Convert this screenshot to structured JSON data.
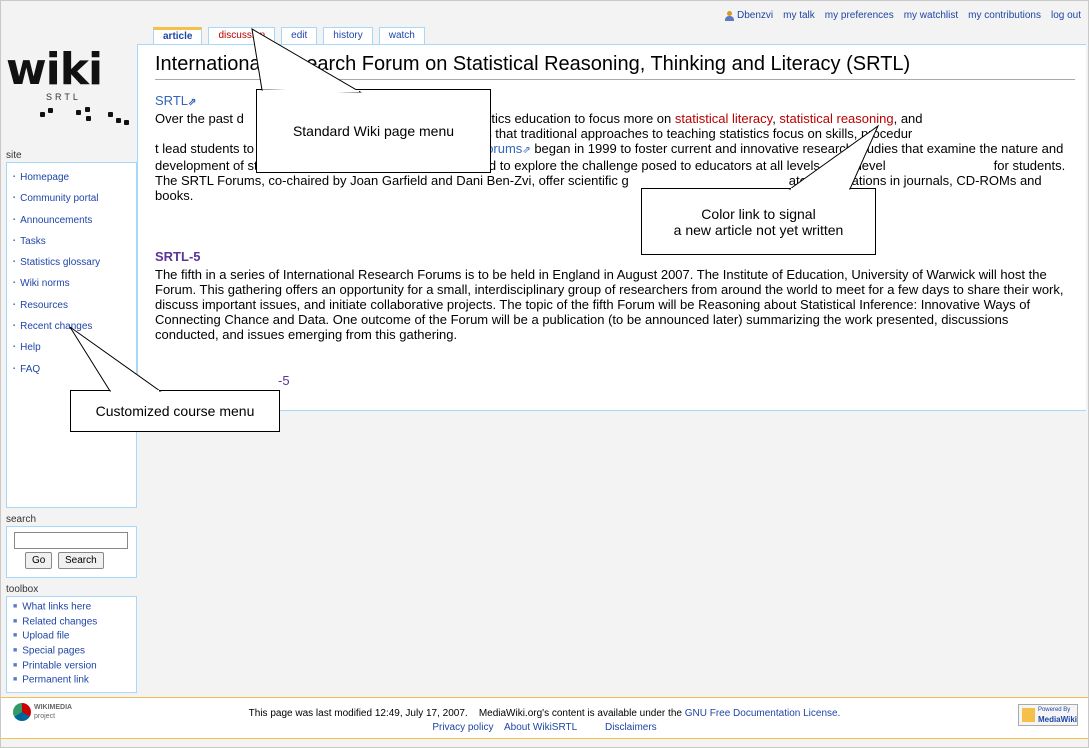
{
  "personal": {
    "user": "Dbenzvi",
    "links": [
      "my talk",
      "my preferences",
      "my watchlist",
      "my contributions",
      "log out"
    ]
  },
  "logo": {
    "text": "wiki",
    "subtext": "SRTL"
  },
  "tabs": [
    {
      "label": "article",
      "state": "selected"
    },
    {
      "label": "discussion",
      "state": "new"
    },
    {
      "label": "edit",
      "state": "normal"
    },
    {
      "label": "history",
      "state": "normal"
    },
    {
      "label": "watch",
      "state": "normal"
    }
  ],
  "page": {
    "title": "International Research Forum on Statistical Reasoning, Thinking and Literacy (SRTL)",
    "section1_heading": "SRTL",
    "para1_parts": [
      {
        "text": "Over the past d"
      },
      {
        "text": "ngly strong call for statistics education to focus more on "
      },
      {
        "text": "statistical literacy",
        "link": "new"
      },
      {
        "text": ", "
      },
      {
        "text": "statistical reasoning",
        "link": "new"
      },
      {
        "text": ", and"
      },
      {
        "text": "h arguments presented is that traditional approaches to teaching statistics focus on skills, procedur"
      },
      {
        "text": "t lead students to reason or think statistically. The "
      },
      {
        "text": "SRTL Forums",
        "link": "ext"
      },
      {
        "text": " began in 1999 to foster current and innovative research studies that examine the nature and development of stati"
      },
      {
        "text": "literacy, reasoning, and thinking, and to explore the challenge posed to educators at all levels — to devel"
      },
      {
        "text": "for students. The SRTL Forums, co-chaired by Joan Garfield and Dani Ben-Zvi, offer scientific g"
      },
      {
        "text": "ated publications in journals, CD-ROMs and books."
      }
    ],
    "section2_heading": "SRTL-5",
    "para2": "The fifth in a series of International Research Forums is to be held in England in August 2007. The Institute of Education, University of Warwick will host the Forum. This gathering offers an opportunity for a small, interdisciplinary group of researchers from around the world to meet for a few days to share their work, discuss important issues, and initiate collaborative projects. The topic of the fifth Forum will be Reasoning about Statistical Inference: Innovative Ways of Connecting Chance and Data. One outcome of the Forum will be a publication (to be announced later) summarizing the work presented, discussions conducted, and issues emerging from this gathering.",
    "fragment": "-5"
  },
  "sidebar": {
    "site_label": "site",
    "items": [
      "Homepage",
      "Community portal",
      "Announcements",
      "Tasks",
      "Statistics glossary",
      "Wiki norms",
      "Resources",
      "Recent changes",
      "Help",
      "FAQ"
    ],
    "search_label": "search",
    "go_label": "Go",
    "search_button": "Search",
    "toolbox_label": "toolbox",
    "toolbox_items": [
      "What links here",
      "Related changes",
      "Upload file",
      "Special pages",
      "Printable version",
      "Permanent link"
    ]
  },
  "callouts": {
    "menu": "Standard Wiki page menu",
    "color_line1": "Color link to signal",
    "color_line2": "a new article not yet written",
    "course": "Customized course menu"
  },
  "footer": {
    "modified": "This page was last modified 12:49, July 17, 2007.",
    "license_prefix": "MediaWiki.org's content is available under the",
    "license_link": "GNU Free Documentation License.",
    "links": [
      "Privacy policy",
      "About WikiSRTL",
      "Disclaimers"
    ],
    "wikimedia": "WIKIMEDIA",
    "wikimedia_sub": "project",
    "mediawiki": "MediaWiki",
    "powered": "Powered By"
  }
}
